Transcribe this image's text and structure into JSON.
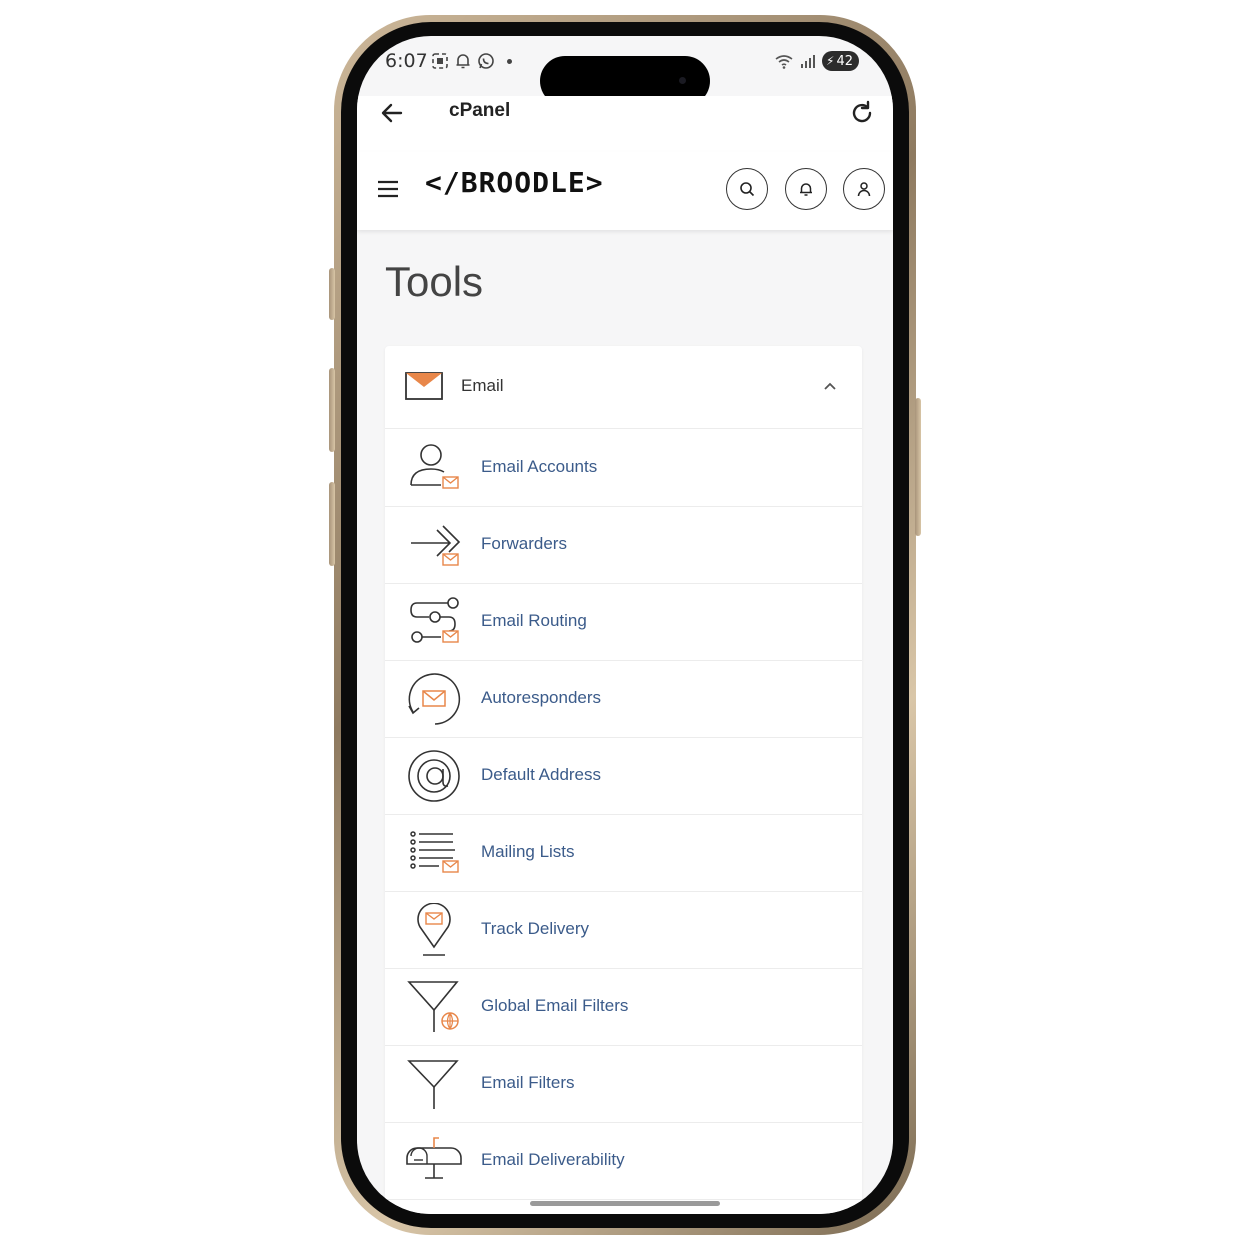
{
  "status_bar": {
    "time": "6:07",
    "battery": "42"
  },
  "app_bar": {
    "title": "cPanel"
  },
  "site_header": {
    "logo": "</BROODLE>"
  },
  "page": {
    "title": "Tools"
  },
  "email_section": {
    "title": "Email",
    "items": [
      {
        "label": "Email Accounts",
        "icon": "email-accounts-icon"
      },
      {
        "label": "Forwarders",
        "icon": "forwarders-icon"
      },
      {
        "label": "Email Routing",
        "icon": "email-routing-icon"
      },
      {
        "label": "Autoresponders",
        "icon": "autoresponders-icon"
      },
      {
        "label": "Default Address",
        "icon": "at-sign-icon"
      },
      {
        "label": "Mailing Lists",
        "icon": "mailing-lists-icon"
      },
      {
        "label": "Track Delivery",
        "icon": "track-delivery-icon"
      },
      {
        "label": "Global Email Filters",
        "icon": "global-filter-icon"
      },
      {
        "label": "Email Filters",
        "icon": "filter-icon"
      },
      {
        "label": "Email Deliverability",
        "icon": "mailbox-icon"
      }
    ]
  },
  "colors": {
    "accent_orange": "#e8874a",
    "link_blue": "#3b5b8a"
  }
}
